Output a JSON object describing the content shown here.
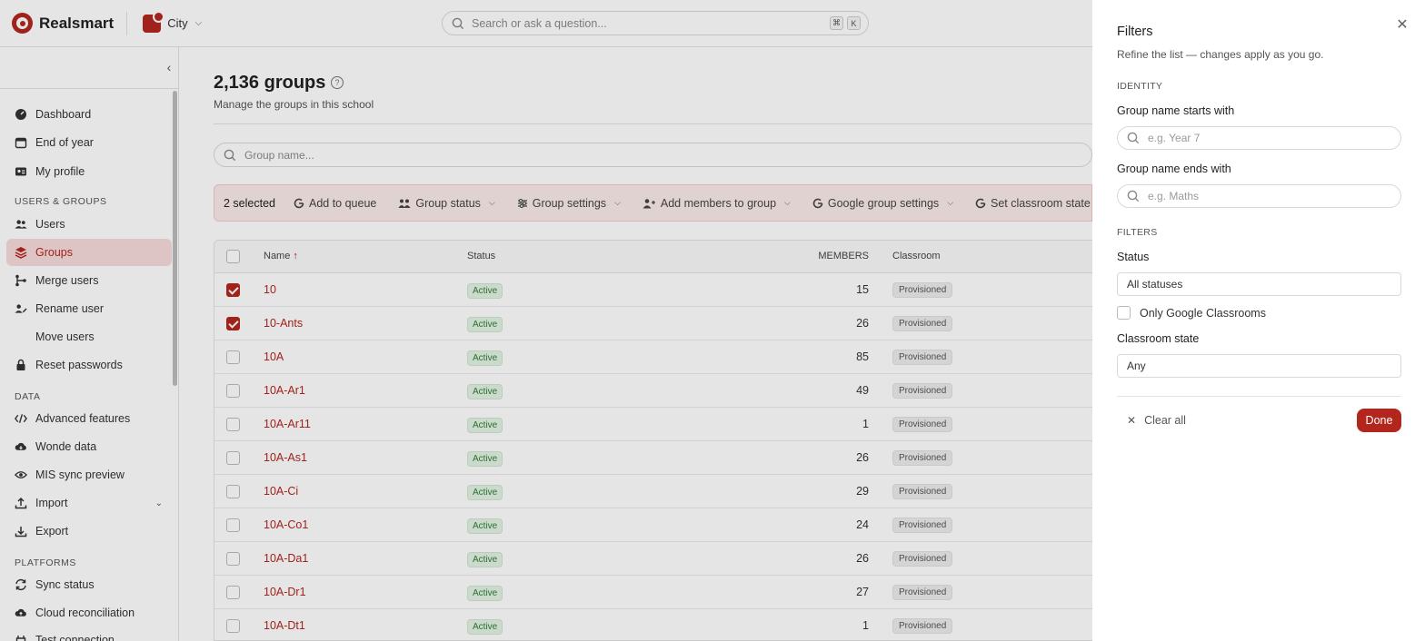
{
  "topbar": {
    "brand": "Realsmart",
    "school": "City",
    "search_placeholder": "Search or ask a question...",
    "shortcut_keys": [
      "⌘",
      "K"
    ]
  },
  "sidebar": {
    "top_items": [
      {
        "label": "Dashboard",
        "icon": "gauge-icon"
      },
      {
        "label": "End of year",
        "icon": "calendar-icon"
      },
      {
        "label": "My profile",
        "icon": "id-card-icon"
      }
    ],
    "sections": [
      {
        "heading": "USERS & GROUPS",
        "items": [
          {
            "label": "Users",
            "icon": "users-icon"
          },
          {
            "label": "Groups",
            "icon": "layers-icon",
            "active": true
          },
          {
            "label": "Merge users",
            "icon": "merge-icon"
          },
          {
            "label": "Rename user",
            "icon": "rename-icon"
          },
          {
            "label": "Move users",
            "icon": ""
          },
          {
            "label": "Reset passwords",
            "icon": "lock-icon"
          }
        ]
      },
      {
        "heading": "DATA",
        "items": [
          {
            "label": "Advanced features",
            "icon": "code-icon"
          },
          {
            "label": "Wonde data",
            "icon": "cloud-download-icon"
          },
          {
            "label": "MIS sync preview",
            "icon": "eye-icon"
          },
          {
            "label": "Import",
            "icon": "upload-icon",
            "expandable": true
          },
          {
            "label": "Export",
            "icon": "download-icon"
          }
        ]
      },
      {
        "heading": "PLATFORMS",
        "items": [
          {
            "label": "Sync status",
            "icon": "sync-icon"
          },
          {
            "label": "Cloud reconciliation",
            "icon": "cloud-upload-icon"
          },
          {
            "label": "Test connection",
            "icon": "plug-icon"
          }
        ]
      }
    ]
  },
  "main": {
    "title": "2,136 groups",
    "subtitle": "Manage the groups in this school",
    "search_placeholder": "Group name...",
    "bulk": {
      "selected": "2 selected",
      "actions": [
        {
          "label": "Add to queue",
          "icon": "google-icon",
          "dropdown": false
        },
        {
          "label": "Group status",
          "icon": "group-icon",
          "dropdown": true
        },
        {
          "label": "Group settings",
          "icon": "sliders-icon",
          "dropdown": true
        },
        {
          "label": "Add members to group",
          "icon": "user-plus-icon",
          "dropdown": true
        },
        {
          "label": "Google group settings",
          "icon": "google-icon",
          "dropdown": true
        },
        {
          "label": "Set classroom state",
          "icon": "google-icon",
          "dropdown": true
        }
      ]
    },
    "table": {
      "columns": {
        "name": "Name",
        "status": "Status",
        "members": "MEMBERS",
        "classroom": "Classroom"
      },
      "rows": [
        {
          "name": "10",
          "status": "Active",
          "members": "15",
          "classroom": "Provisioned",
          "checked": true
        },
        {
          "name": "10-Ants",
          "status": "Active",
          "members": "26",
          "classroom": "Provisioned",
          "checked": true
        },
        {
          "name": "10A",
          "status": "Active",
          "members": "85",
          "classroom": "Provisioned",
          "checked": false
        },
        {
          "name": "10A-Ar1",
          "status": "Active",
          "members": "49",
          "classroom": "Provisioned",
          "checked": false
        },
        {
          "name": "10A-Ar11",
          "status": "Active",
          "members": "1",
          "classroom": "Provisioned",
          "checked": false
        },
        {
          "name": "10A-As1",
          "status": "Active",
          "members": "26",
          "classroom": "Provisioned",
          "checked": false
        },
        {
          "name": "10A-Ci",
          "status": "Active",
          "members": "29",
          "classroom": "Provisioned",
          "checked": false
        },
        {
          "name": "10A-Co1",
          "status": "Active",
          "members": "24",
          "classroom": "Provisioned",
          "checked": false
        },
        {
          "name": "10A-Da1",
          "status": "Active",
          "members": "26",
          "classroom": "Provisioned",
          "checked": false
        },
        {
          "name": "10A-Dr1",
          "status": "Active",
          "members": "27",
          "classroom": "Provisioned",
          "checked": false
        },
        {
          "name": "10A-Dt1",
          "status": "Active",
          "members": "1",
          "classroom": "Provisioned",
          "checked": false
        }
      ]
    }
  },
  "drawer": {
    "title": "Filters",
    "subtitle": "Refine the list — changes apply as you go.",
    "identity_heading": "IDENTITY",
    "starts_label": "Group name starts with",
    "starts_placeholder": "e.g. Year 7",
    "ends_label": "Group name ends with",
    "ends_placeholder": "e.g. Maths",
    "filters_heading": "FILTERS",
    "status_label": "Status",
    "status_value": "All statuses",
    "only_google": "Only Google Classrooms",
    "classroom_state_label": "Classroom state",
    "classroom_state_value": "Any",
    "clear_all": "Clear all",
    "done": "Done"
  },
  "colors": {
    "accent": "#b3261e",
    "accent_soft": "#fbeaea",
    "active_green": "#2e7d32"
  }
}
